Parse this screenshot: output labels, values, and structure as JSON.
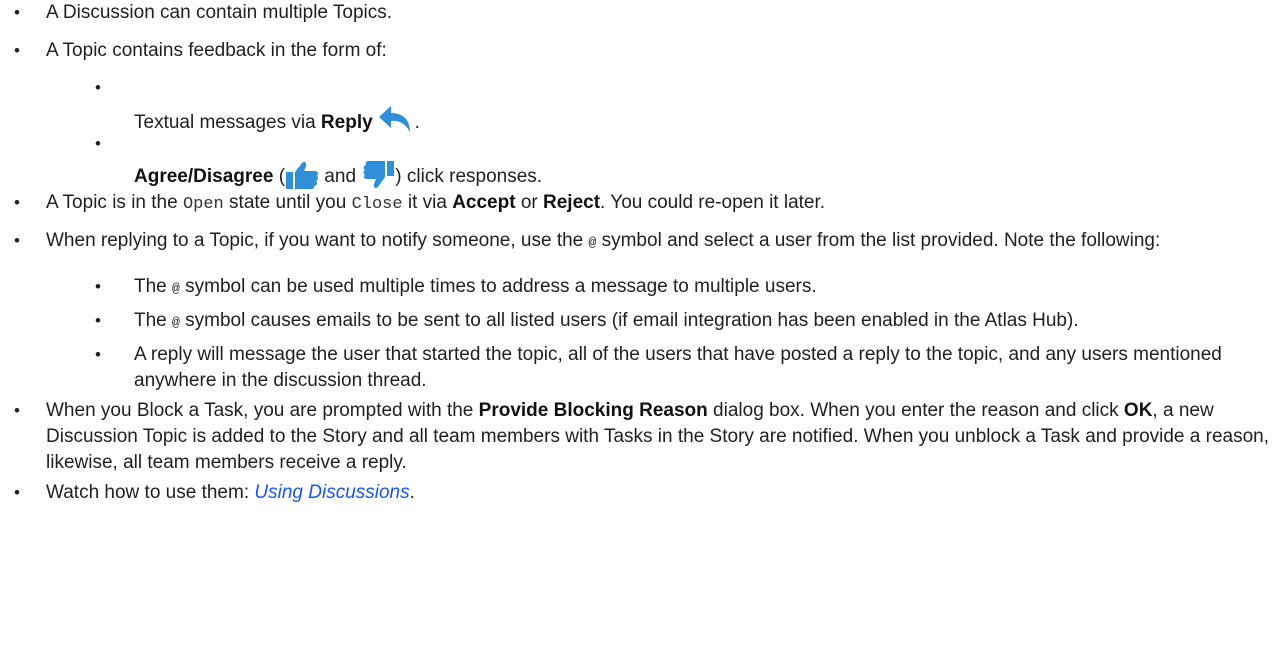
{
  "items": {
    "i1": {
      "text": "A Discussion can contain multiple Topics."
    },
    "i2": {
      "text": "A Topic contains feedback in the form of:"
    },
    "i2a": {
      "pre": "Textual messages via ",
      "bold": "Reply",
      "post": "."
    },
    "i2b": {
      "bold1": "Agree",
      "slash": "/",
      "bold2": "Disagree",
      "open_paren": " (",
      "and": " and ",
      "close": ") click responses."
    },
    "i3": {
      "t1": "A Topic is in the ",
      "code1": "Open",
      "t2": " state until you ",
      "code2": "Close",
      "t3": " it via ",
      "b1": "Accept",
      "t4": " or ",
      "b2": "Reject",
      "t5": ". You could re-open it later."
    },
    "i4": {
      "t1": "When replying to a Topic, if you want to notify someone, use the ",
      "at": "@",
      "t2": " symbol and select a user from the list provided. Note the following:"
    },
    "i4a": {
      "t1": "The ",
      "at": "@",
      "t2": " symbol can be used multiple times to address a message to multiple users."
    },
    "i4b": {
      "t1": "The ",
      "at": "@",
      "t2": " symbol causes emails to be sent to all listed users (if email integration has been enabled in the Atlas Hub)."
    },
    "i4c": {
      "text": "A reply will message the user that started the topic, all of the users that have posted a reply to the topic, and any users mentioned anywhere in the discussion thread."
    },
    "i5": {
      "t1": "When you Block a Task, you are prompted with the ",
      "b1": "Provide Blocking Reason",
      "t2": " dialog box. When you enter the reason and click ",
      "b2": "OK",
      "t3": ", a new Discussion Topic is added to the Story and all team members with Tasks in the Story are notified. When you unblock a Task and provide a reason, likewise, all team members receive a reply."
    },
    "i6": {
      "t1": "Watch how to use them: ",
      "link": "Using Discussions",
      "t2": "."
    }
  },
  "icons": {
    "reply": "reply-arrow-icon",
    "agree": "thumbs-up-icon",
    "disagree": "thumbs-down-icon"
  },
  "colors": {
    "icon_blue": "#2f8fd8",
    "link": "#1a56e8",
    "text": "#1f1f1f"
  },
  "bullet": "•"
}
